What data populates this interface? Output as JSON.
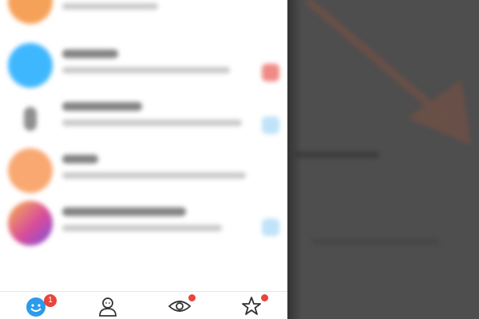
{
  "colors": {
    "accent": "#2b9bea",
    "badge": "#e9453d",
    "panel_dim": "#4e4e4e",
    "arrow": "#6b5047"
  },
  "chat_list": {
    "rows": [
      {
        "avatar_color": "#f6a15a",
        "side_marker_color": ""
      },
      {
        "avatar_color": "#3fb7ff",
        "side_marker_color": "#f08a86"
      },
      {
        "avatar_color": "#8f8f8f",
        "side_marker_color": "#bfe3f8"
      },
      {
        "avatar_color": "#f9a872",
        "side_marker_color": ""
      },
      {
        "avatar_color": "#d94d9b",
        "side_marker_color": "#bfe3f8"
      }
    ]
  },
  "tabbar": {
    "tabs": [
      {
        "icon": "chat-face-icon",
        "badge": "1"
      },
      {
        "icon": "contacts-icon",
        "badge": ""
      },
      {
        "icon": "eye-icon",
        "badge_dot": true
      },
      {
        "icon": "star-icon",
        "badge_dot": true
      }
    ]
  },
  "overlay": {
    "arrow_icon": "arrow-icon"
  }
}
